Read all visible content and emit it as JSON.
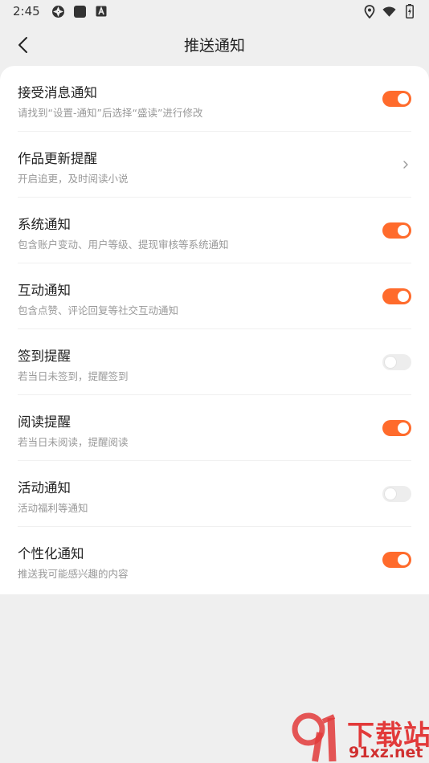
{
  "status_bar": {
    "time": "2:45",
    "left_icons": [
      "shutter-icon",
      "square-icon",
      "a-box-icon"
    ],
    "right_icons": [
      "location-icon",
      "wifi-icon",
      "battery-icon"
    ]
  },
  "header": {
    "title": "推送通知",
    "back_icon": "chevron-left-icon"
  },
  "settings": [
    {
      "title": "接受消息通知",
      "subtitle": "请找到“设置-通知”后选择“盛读”进行修改",
      "control": "toggle",
      "on": true
    },
    {
      "title": "作品更新提醒",
      "subtitle": "开启追更，及时阅读小说",
      "control": "chevron"
    },
    {
      "title": "系统通知",
      "subtitle": "包含账户变动、用户等级、提现审核等系统通知",
      "control": "toggle",
      "on": true
    },
    {
      "title": "互动通知",
      "subtitle": "包含点赞、评论回复等社交互动通知",
      "control": "toggle",
      "on": true
    },
    {
      "title": "签到提醒",
      "subtitle": "若当日未签到，提醒签到",
      "control": "toggle",
      "on": false
    },
    {
      "title": "阅读提醒",
      "subtitle": "若当日未阅读，提醒阅读",
      "control": "toggle",
      "on": true
    },
    {
      "title": "活动通知",
      "subtitle": "活动福利等通知",
      "control": "toggle",
      "on": false
    },
    {
      "title": "个性化通知",
      "subtitle": "推送我可能感兴趣的内容",
      "control": "toggle",
      "on": true
    }
  ],
  "colors": {
    "accent": "#ff6b2c",
    "toggle_off": "#ededed",
    "background": "#efefef",
    "card": "#ffffff"
  },
  "watermark": {
    "text_cn": "下载站",
    "text_url": "91xz.net"
  }
}
